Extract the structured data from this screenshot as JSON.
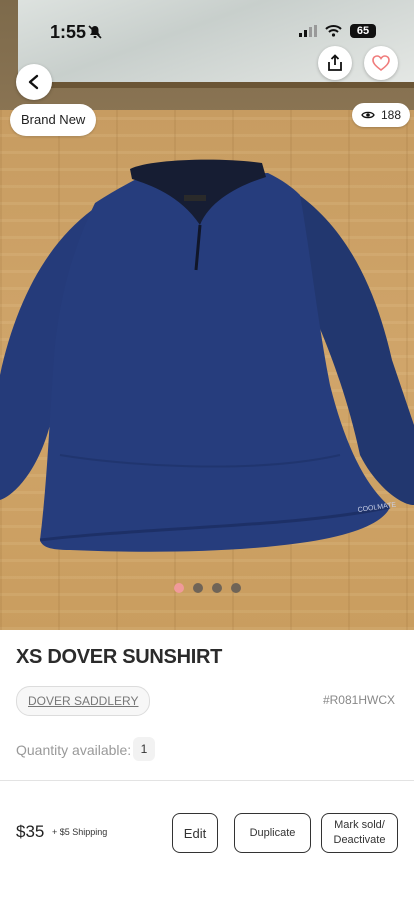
{
  "status_bar": {
    "time": "1:55",
    "battery": "65"
  },
  "listing": {
    "condition": "Brand New",
    "views": "188",
    "image_count": 4,
    "active_image_index": 0,
    "title": "XS DOVER SUNSHIRT",
    "brand": "DOVER SADDLERY",
    "sku": "#R081HWCX",
    "quantity_label": "Quantity available:",
    "quantity": "1",
    "price": "$35",
    "shipping": "+ $5 Shipping"
  },
  "actions": {
    "edit": "Edit",
    "duplicate": "Duplicate",
    "mark_sold": "Mark sold/ Deactivate"
  },
  "colors": {
    "accent_dot": "#f09a9a",
    "shirt": "#243a76"
  }
}
